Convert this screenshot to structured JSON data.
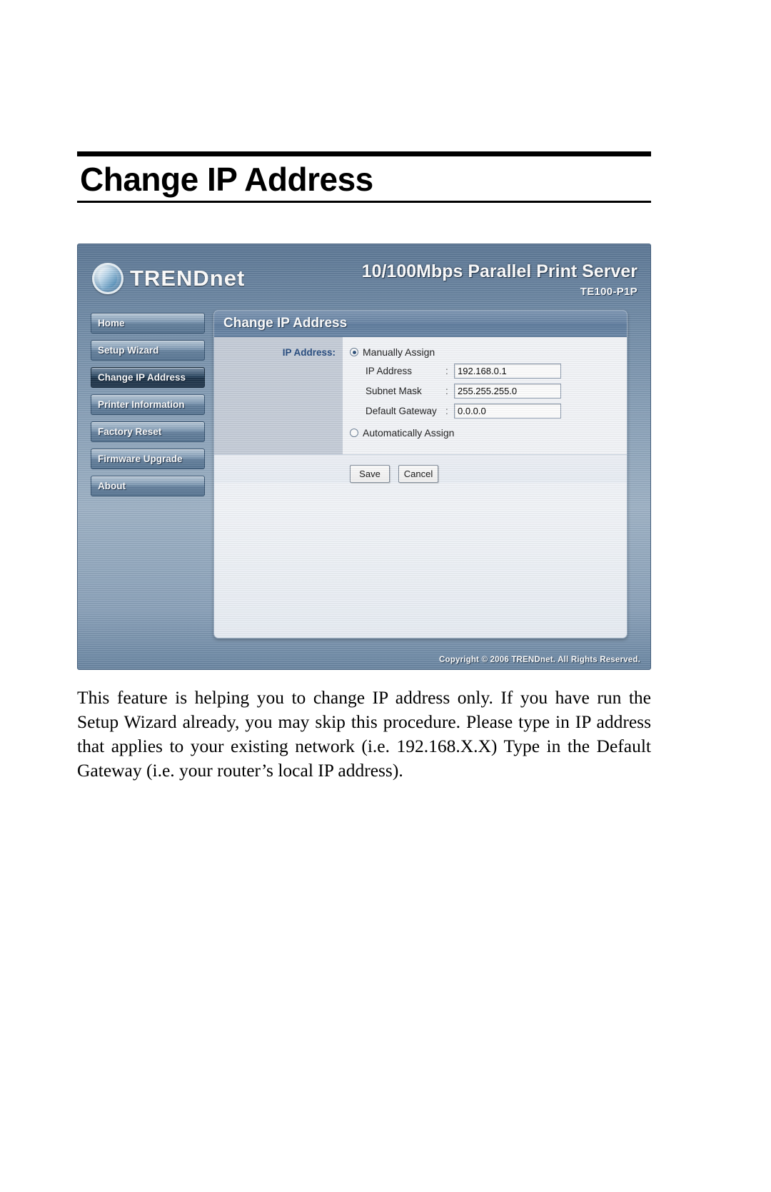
{
  "page": {
    "heading": "Change IP Address",
    "body_paragraph": "This feature is helping you to change IP address only.    If you have run the Setup Wizard already, you may skip this procedure. Please type in IP address that applies to your existing network (i.e. 192.168.X.X) Type in the Default Gateway (i.e. your router’s local IP address)."
  },
  "device": {
    "brand": "TRENDnet",
    "product_name": "10/100Mbps Parallel Print Server",
    "model": "TE100-P1P",
    "footer_copyright": "Copyright © 2006 TRENDnet. All Rights Reserved.",
    "sidebar": {
      "items": [
        {
          "label": "Home",
          "active": false
        },
        {
          "label": "Setup Wizard",
          "active": false
        },
        {
          "label": "Change IP Address",
          "active": true
        },
        {
          "label": "Printer Information",
          "active": false
        },
        {
          "label": "Factory Reset",
          "active": false
        },
        {
          "label": "Firmware Upgrade",
          "active": false
        },
        {
          "label": "About",
          "active": false
        }
      ]
    },
    "card": {
      "title": "Change IP Address",
      "section_label": "IP Address:",
      "radio_manual": "Manually Assign",
      "radio_auto": "Automatically Assign",
      "selected_mode": "Manually Assign",
      "fields": [
        {
          "name": "IP Address",
          "separator": ":",
          "value": "192.168.0.1"
        },
        {
          "name": "Subnet Mask",
          "separator": ":",
          "value": "255.255.255.0"
        },
        {
          "name": "Default Gateway",
          "separator": ":",
          "value": "0.0.0.0"
        }
      ],
      "buttons": {
        "save": "Save",
        "cancel": "Cancel"
      }
    }
  },
  "colors": {
    "chrome_blue": "#6d88a4",
    "nav_active": "#29455f",
    "card_title_blue": "#6a86a6",
    "label_blue": "#23497e",
    "form_left_gray": "#c6ced9"
  }
}
